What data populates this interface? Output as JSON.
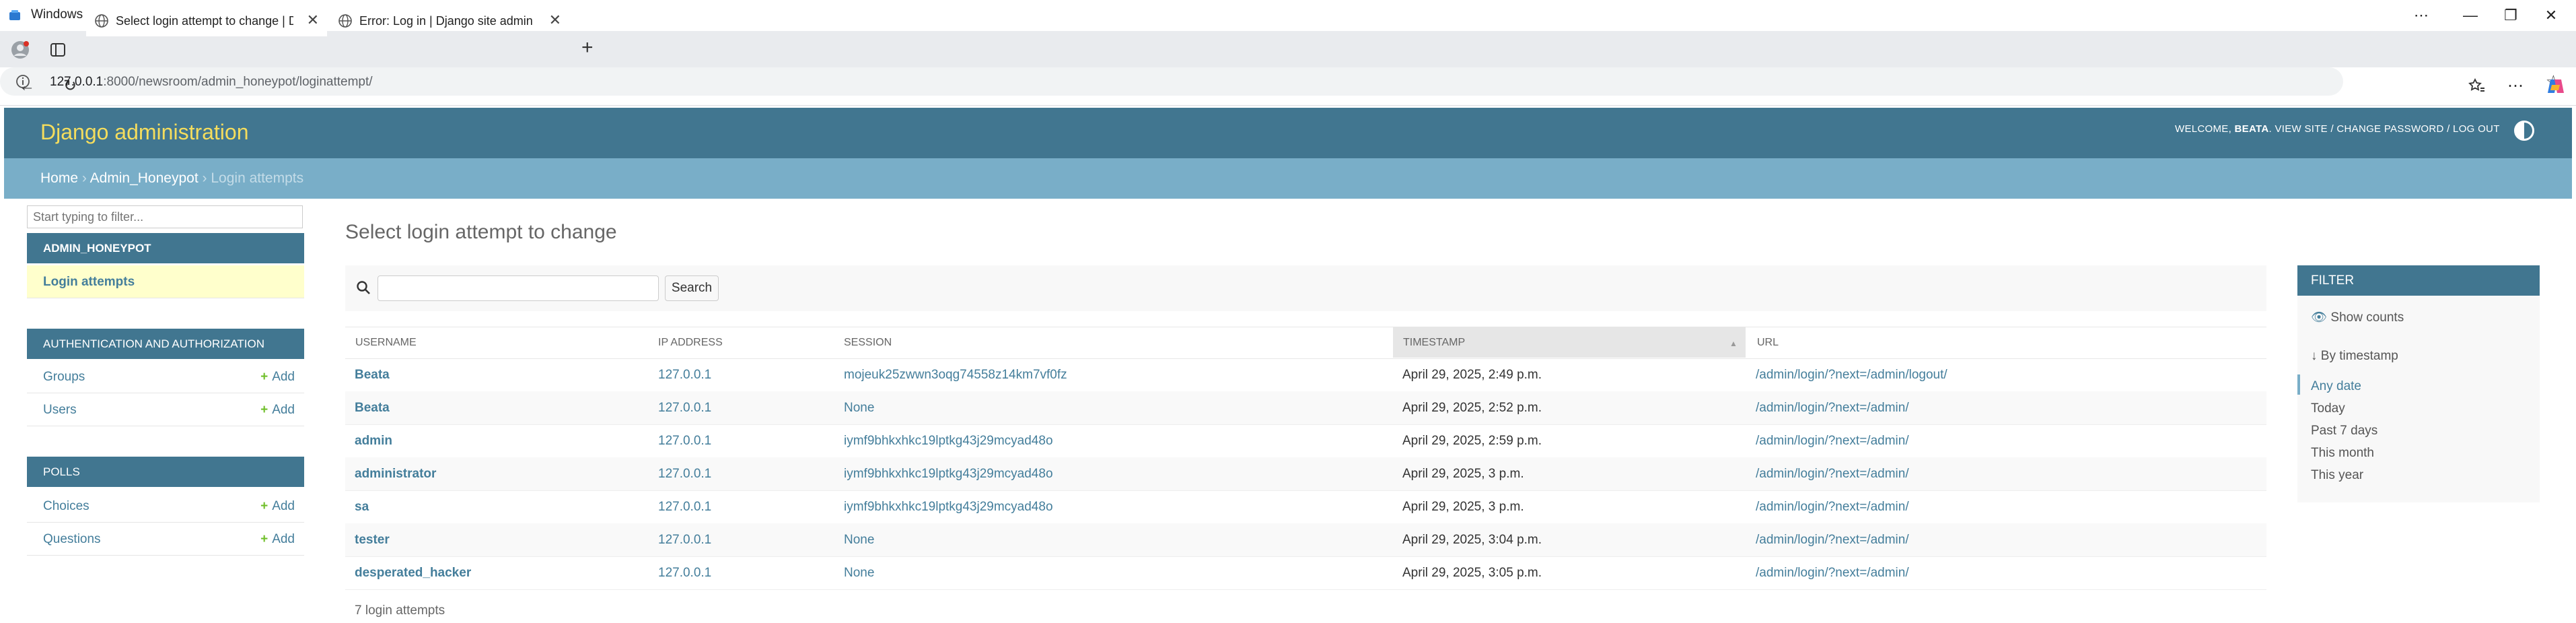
{
  "window": {
    "title": "Windows Sandbox"
  },
  "tabs": [
    {
      "label": "Select login attempt to change | D",
      "active": true
    },
    {
      "label": "Error: Log in | Django site admin",
      "active": false
    }
  ],
  "address": {
    "host": "127.0.0.1",
    "path": ":8000/newsroom/admin_honeypot/loginattempt/"
  },
  "header": {
    "brand": "Django administration",
    "welcome": "Welcome,",
    "user": "Beata",
    "view_site": "View site",
    "change_password": "Change password",
    "log_out": "Log out",
    "sep": "/"
  },
  "breadcrumbs": {
    "home": "Home",
    "app": "Admin_Honeypot",
    "current": "Login attempts",
    "sep": "›"
  },
  "sidebar": {
    "filter_placeholder": "Start typing to filter...",
    "apps": [
      {
        "caption": "Admin_Honeypot",
        "models": [
          {
            "name": "Login attempts",
            "current": true
          }
        ]
      },
      {
        "caption": "Authentication and Authorization",
        "models": [
          {
            "name": "Groups",
            "add": "Add"
          },
          {
            "name": "Users",
            "add": "Add"
          }
        ]
      },
      {
        "caption": "Polls",
        "models": [
          {
            "name": "Choices",
            "add": "Add"
          },
          {
            "name": "Questions",
            "add": "Add"
          }
        ]
      }
    ]
  },
  "main": {
    "title": "Select login attempt to change",
    "search_button": "Search",
    "columns": [
      "Username",
      "IP address",
      "Session",
      "Timestamp",
      "URL"
    ],
    "rows": [
      {
        "username": "Beata",
        "ip": "127.0.0.1",
        "session": "mojeuk25zwwn3oqg74558z14km7vf0fz",
        "timestamp": "April 29, 2025, 2:49 p.m.",
        "url": "/admin/login/?next=/admin/logout/"
      },
      {
        "username": "Beata",
        "ip": "127.0.0.1",
        "session": "None",
        "timestamp": "April 29, 2025, 2:52 p.m.",
        "url": "/admin/login/?next=/admin/"
      },
      {
        "username": "admin",
        "ip": "127.0.0.1",
        "session": "iymf9bhkxhkc19lptkg43j29mcyad48o",
        "timestamp": "April 29, 2025, 2:59 p.m.",
        "url": "/admin/login/?next=/admin/"
      },
      {
        "username": "administrator",
        "ip": "127.0.0.1",
        "session": "iymf9bhkxhkc19lptkg43j29mcyad48o",
        "timestamp": "April 29, 2025, 3 p.m.",
        "url": "/admin/login/?next=/admin/"
      },
      {
        "username": "sa",
        "ip": "127.0.0.1",
        "session": "iymf9bhkxhkc19lptkg43j29mcyad48o",
        "timestamp": "April 29, 2025, 3 p.m.",
        "url": "/admin/login/?next=/admin/"
      },
      {
        "username": "tester",
        "ip": "127.0.0.1",
        "session": "None",
        "timestamp": "April 29, 2025, 3:04 p.m.",
        "url": "/admin/login/?next=/admin/"
      },
      {
        "username": "desperated_hacker",
        "ip": "127.0.0.1",
        "session": "None",
        "timestamp": "April 29, 2025, 3:05 p.m.",
        "url": "/admin/login/?next=/admin/"
      }
    ],
    "paginator": "7 login attempts"
  },
  "filter": {
    "title": "Filter",
    "show_counts": "Show counts",
    "by_timestamp": "By timestamp",
    "options": [
      "Any date",
      "Today",
      "Past 7 days",
      "This month",
      "This year"
    ],
    "selected": "Any date"
  },
  "colors": {
    "header": "#417690",
    "breadcrumbs": "#79aec8",
    "brand": "#f5dd5d",
    "link": "#447e9b",
    "current_model": "#ffffcc",
    "add_plus": "#70bf2b"
  }
}
